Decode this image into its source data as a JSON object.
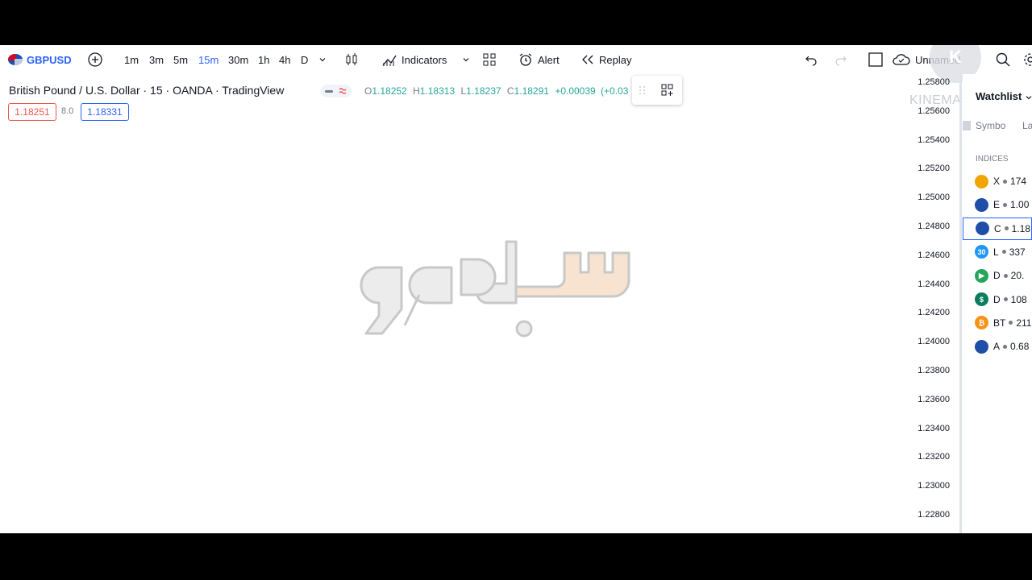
{
  "toolbar": {
    "symbol": "GBPUSD",
    "timeframes": [
      "1m",
      "3m",
      "5m",
      "15m",
      "30m",
      "1h",
      "4h",
      "D"
    ],
    "active_timeframe": "15m",
    "indicators_label": "Indicators",
    "alert_label": "Alert",
    "replay_label": "Replay",
    "layout_name": "Unnamed"
  },
  "legend": {
    "title": "British Pound / U.S. Dollar · 15 · OANDA · TradingView",
    "ohlc": {
      "o": "1.18252",
      "h": "1.18313",
      "l": "1.18237",
      "c": "1.18291",
      "change": "+0.00039",
      "change_pct": "(+0.03"
    },
    "sell_price": "1.18251",
    "spread": "8.0",
    "buy_price": "1.18331"
  },
  "price_axis": {
    "ticks": [
      "1.25800",
      "1.25600",
      "1.25400",
      "1.25200",
      "1.25000",
      "1.24800",
      "1.24600",
      "1.24400",
      "1.24200",
      "1.24000",
      "1.23800",
      "1.23600",
      "1.23400",
      "1.23200",
      "1.23000",
      "1.22800"
    ]
  },
  "watchlist": {
    "title": "Watchlist",
    "col_symbol": "Symbo",
    "col_last": "La",
    "section": "INDICES",
    "rows": [
      {
        "sym": "X",
        "price": "174",
        "icon_color": "#f0a500",
        "icon_text": ""
      },
      {
        "sym": "E",
        "price": "1.00",
        "icon_color": "#1e4ea8",
        "icon_text": ""
      },
      {
        "sym": "C",
        "price": "1.18",
        "icon_color": "#1e4ea8",
        "icon_text": ""
      },
      {
        "sym": "L",
        "price": "337",
        "icon_color": "#2196f3",
        "icon_text": "30"
      },
      {
        "sym": "D",
        "price": "20.",
        "icon_color": "#26a65b",
        "icon_text": "▶"
      },
      {
        "sym": "D",
        "price": "108",
        "icon_color": "#0a7e5c",
        "icon_text": "$"
      },
      {
        "sym": "BT",
        "price": "211",
        "icon_color": "#f7931a",
        "icon_text": "₿"
      },
      {
        "sym": "A",
        "price": "0.68",
        "icon_color": "#1e4ea8",
        "icon_text": ""
      }
    ],
    "selected_index": 2
  },
  "overlay": {
    "kinemaster": "KINEMASTER",
    "badge": "K"
  },
  "colors": {
    "accent": "#2962ff",
    "up": "#26a69a",
    "down": "#ef5350",
    "watermark_light": "#f7e3cf",
    "watermark_grey": "#ececec"
  }
}
